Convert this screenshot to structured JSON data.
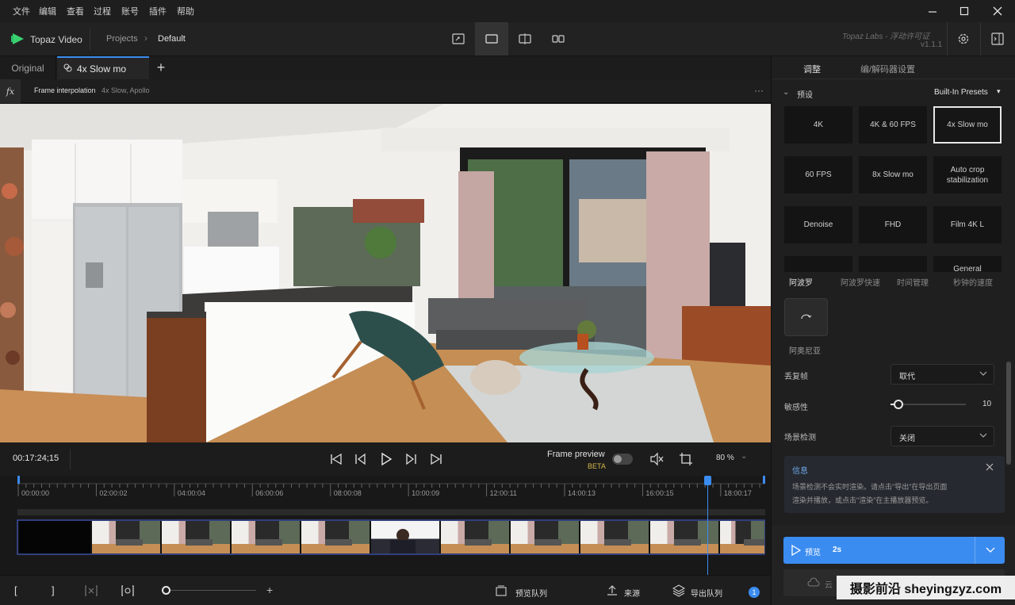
{
  "menubar": {
    "items": [
      "文件",
      "编辑",
      "查看",
      "过程",
      "账号",
      "插件",
      "帮助"
    ]
  },
  "window": {
    "minimize_icon": "minimize-icon",
    "maximize_icon": "maximize-icon",
    "close_icon": "close-icon"
  },
  "header": {
    "app_name": "Topaz Video",
    "breadcrumb_root": "Projects",
    "breadcrumb_current": "Default",
    "license_text": "Topaz Labs - 浮动许可证",
    "version": "v1.1.1"
  },
  "tabs": {
    "original": "Original",
    "active": "4x Slow mo",
    "add": "+"
  },
  "fx": {
    "icon_label": "fx",
    "title": "Frame interpolation",
    "detail": "4x Slow, Apollo",
    "more": "···"
  },
  "playbar": {
    "timecode": "00:17:24;15",
    "frame_preview_label": "Frame preview",
    "beta_label": "BETA",
    "zoom": "80 %"
  },
  "timeline": {
    "ticks": [
      "00:00:00",
      "02:00:02",
      "04:00:04",
      "06:00:06",
      "08:00:08",
      "10:00:09",
      "12:00:11",
      "14:00:13",
      "16:00:15",
      "18:00:17"
    ]
  },
  "bottombar": {
    "mark_in": "[",
    "mark_out": "]",
    "zoom_plus": "+",
    "preview_queue": "预览队列",
    "source": "来源",
    "export_queue": "导出队列",
    "export_count": "1"
  },
  "rpanel": {
    "tab_adjust": "调整",
    "tab_codec": "编/解码器设置",
    "presets_label": "预设",
    "presets_source": "Built-In Presets",
    "presets": [
      "4K",
      "4K & 60 FPS",
      "4x Slow mo",
      "60 FPS",
      "8x Slow mo",
      "Auto crop stabilization",
      "Denoise",
      "FHD",
      "Film 4K L",
      "",
      "",
      "General"
    ],
    "selected_preset": "4x Slow mo",
    "subtabs": [
      "阿波罗",
      "阿波罗快速",
      "时间管理",
      "秒钟的速度"
    ],
    "model_label": "阿奥尼亚",
    "duplicate_label": "丢复帧",
    "duplicate_value": "取代",
    "sensitivity_label": "敏感性",
    "sensitivity_value": "10",
    "sensitivity_level": 0.1,
    "scene_label": "场景检测",
    "scene_value": "关闭",
    "info_title": "信息",
    "info_text_1": "场景检测不会实时渲染。请点击\"导出\"在导出页面",
    "info_text_2": "渲染并播放，或点击\"渲染\"在主播放器预览。",
    "preview_button": "预览",
    "preview_duration": "2s",
    "cloud_label": "云"
  },
  "watermark": "摄影前沿 sheyingzyz.com",
  "colors": {
    "accent_blue": "#3b8cf0",
    "playhead": "#3b8cf0",
    "beta": "#d6b64a",
    "logo_green": "#3ad26f"
  }
}
